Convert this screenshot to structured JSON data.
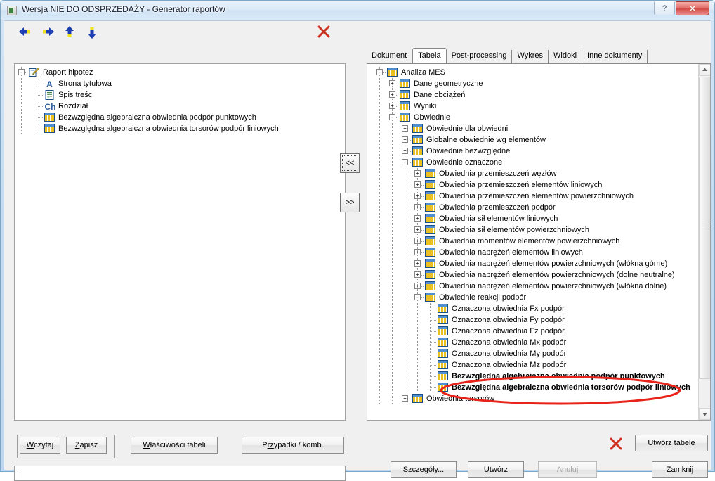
{
  "window": {
    "title": "Wersja NIE DO ODSPRZEDAŻY - Generator raportów",
    "help_label": "?",
    "close_label": "✕",
    "accent_title": "#cfe2f4",
    "close_red": "#d24a45",
    "annotation_red": "#e8231a"
  },
  "toolbar": {
    "items": [
      {
        "name": "back-arrow-icon",
        "label": "Wstecz"
      },
      {
        "name": "forward-arrow-icon",
        "label": "Dalej"
      },
      {
        "name": "up-arrow-icon",
        "label": "W górę"
      },
      {
        "name": "down-arrow-icon",
        "label": "W dół"
      }
    ],
    "delete_label": "✕"
  },
  "left_tree": {
    "nodes": [
      {
        "label": "Raport hipotez",
        "depth": 0,
        "twisty": "-",
        "icon": "report-pen-icon"
      },
      {
        "label": "Strona tytułowa",
        "depth": 1,
        "twisty": "",
        "icon": "letter-a-icon"
      },
      {
        "label": "Spis treści",
        "depth": 1,
        "twisty": "",
        "icon": "contents-page-icon"
      },
      {
        "label": "Rozdział",
        "depth": 1,
        "twisty": "",
        "icon": "chapter-ch-icon"
      },
      {
        "label": "Bezwzględna algebraiczna obwiednia podpór punktowych",
        "depth": 1,
        "twisty": "",
        "icon": "table-grid-icon"
      },
      {
        "label": "Bezwzględna algebraiczna obwiednia torsorów podpór liniowych",
        "depth": 1,
        "twisty": "",
        "icon": "table-grid-icon"
      }
    ]
  },
  "transfer": {
    "add_label": "<<",
    "remove_label": ">>"
  },
  "tabs": [
    {
      "label": "Dokument",
      "active": false
    },
    {
      "label": "Tabela",
      "active": true
    },
    {
      "label": "Post-processing",
      "active": false
    },
    {
      "label": "Wykres",
      "active": false
    },
    {
      "label": "Widoki",
      "active": false
    },
    {
      "label": "Inne dokumenty",
      "active": false
    }
  ],
  "right_tree": {
    "nodes": [
      {
        "label": "Analiza MES",
        "depth": 0,
        "twisty": "-",
        "bold": false
      },
      {
        "label": "Dane geometryczne",
        "depth": 1,
        "twisty": "+",
        "bold": false
      },
      {
        "label": "Dane obciążeń",
        "depth": 1,
        "twisty": "+",
        "bold": false
      },
      {
        "label": "Wyniki",
        "depth": 1,
        "twisty": "+",
        "bold": false
      },
      {
        "label": "Obwiednie",
        "depth": 1,
        "twisty": "-",
        "bold": false
      },
      {
        "label": "Obwiednie dla obwiedni",
        "depth": 2,
        "twisty": "+",
        "bold": false
      },
      {
        "label": "Globalne obwiednie wg elementów",
        "depth": 2,
        "twisty": "+",
        "bold": false
      },
      {
        "label": "Obwiednie bezwzględne",
        "depth": 2,
        "twisty": "+",
        "bold": false
      },
      {
        "label": "Obwiednie oznaczone",
        "depth": 2,
        "twisty": "-",
        "bold": false
      },
      {
        "label": "Obwiednia przemieszczeń węzłów",
        "depth": 3,
        "twisty": "+",
        "bold": false
      },
      {
        "label": "Obwiednia przemieszczeń elementów liniowych",
        "depth": 3,
        "twisty": "+",
        "bold": false
      },
      {
        "label": "Obwiednia przemieszczeń elementów powierzchniowych",
        "depth": 3,
        "twisty": "+",
        "bold": false
      },
      {
        "label": "Obwiednia przemieszczeń podpór",
        "depth": 3,
        "twisty": "+",
        "bold": false
      },
      {
        "label": "Obwiednia sił elementów liniowych",
        "depth": 3,
        "twisty": "+",
        "bold": false
      },
      {
        "label": "Obwiednia sił elementów powierzchniowych",
        "depth": 3,
        "twisty": "+",
        "bold": false
      },
      {
        "label": "Obwiednia momentów elementów powierzchniowych",
        "depth": 3,
        "twisty": "+",
        "bold": false
      },
      {
        "label": "Obwiednia naprężeń elementów liniowych",
        "depth": 3,
        "twisty": "+",
        "bold": false
      },
      {
        "label": "Obwiednia naprężeń elementów powierzchniowych (włókna górne)",
        "depth": 3,
        "twisty": "+",
        "bold": false
      },
      {
        "label": "Obwiednia naprężeń elementów powierzchniowych (dolne neutralne)",
        "depth": 3,
        "twisty": "+",
        "bold": false
      },
      {
        "label": "Obwiednia naprężeń elementów powierzchniowych (włókna dolne)",
        "depth": 3,
        "twisty": "+",
        "bold": false
      },
      {
        "label": "Obwiednie reakcji podpór",
        "depth": 3,
        "twisty": "-",
        "bold": false
      },
      {
        "label": "Oznaczona obwiednia Fx podpór",
        "depth": 4,
        "twisty": "",
        "bold": false
      },
      {
        "label": "Oznaczona obwiednia Fy podpór",
        "depth": 4,
        "twisty": "",
        "bold": false
      },
      {
        "label": "Oznaczona obwiednia Fz podpór",
        "depth": 4,
        "twisty": "",
        "bold": false
      },
      {
        "label": "Oznaczona obwiednia Mx podpór",
        "depth": 4,
        "twisty": "",
        "bold": false
      },
      {
        "label": "Oznaczona obwiednia My podpór",
        "depth": 4,
        "twisty": "",
        "bold": false
      },
      {
        "label": "Oznaczona obwiednia Mz podpór",
        "depth": 4,
        "twisty": "",
        "bold": false
      },
      {
        "label": "Bezwzględna algebraiczna obwiednia podpór punktowych",
        "depth": 4,
        "twisty": "",
        "bold": true
      },
      {
        "label": "Bezwzględna algebraiczna obwiednia torsorów podpór liniowych",
        "depth": 4,
        "twisty": "",
        "bold": true
      },
      {
        "label": "Obwiednia torsorów",
        "depth": 2,
        "twisty": "+",
        "bold": false
      }
    ]
  },
  "bottom_left": {
    "load_label": "Wczytaj",
    "load_mnemonic": "W",
    "save_label": "Zapisz",
    "save_mnemonic": "Z",
    "table_props_label": "Właściwości tabeli",
    "table_props_mnemonic": "Wł",
    "cases_label": "Przypadki / komb.",
    "cases_mnemonic": "rz",
    "status_value": ""
  },
  "bottom_right": {
    "create_table_label": "Utwórz tabele",
    "details_label": "Szczegóły...",
    "details_mnemonic": "S",
    "create_label": "Utwórz",
    "create_mnemonic": "U",
    "cancel_label": "Anuluj",
    "cancel_mnemonic": "n",
    "cancel_disabled": true,
    "close_label": "Zamknij",
    "close_mnemonic": "Z"
  }
}
